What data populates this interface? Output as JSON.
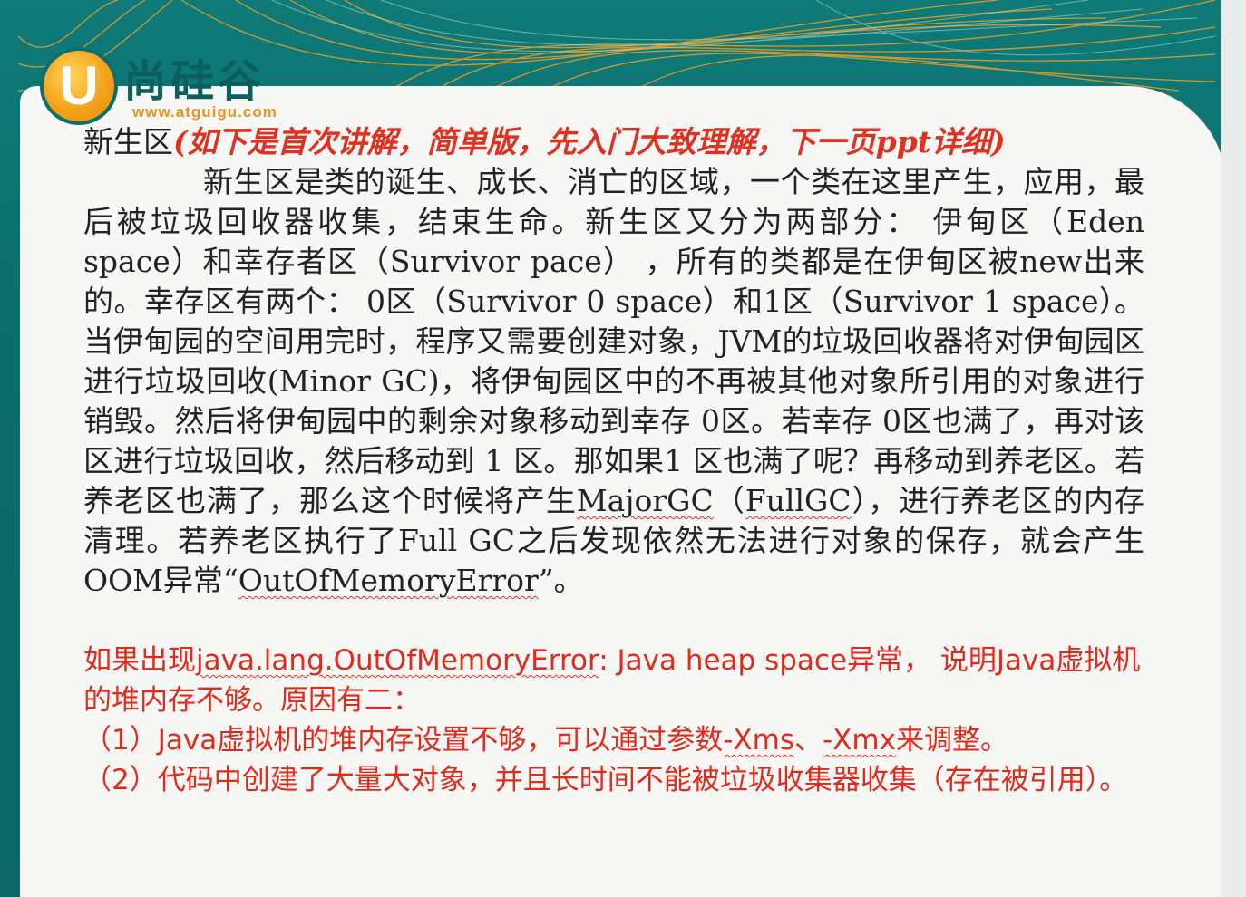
{
  "logo": {
    "mark": "U",
    "name": "尚硅谷",
    "url": "www.atguigu.com"
  },
  "colors": {
    "background_teal": "#0f7a78",
    "accent_orange": "#f5a31a",
    "panel": "#f7f7f5",
    "highlight_red": "#e02b1c",
    "text": "#222222"
  },
  "heading": {
    "title": "新生区",
    "note": "(如下是首次讲解，简单版，先入门大致理解，下一页ppt详细)"
  },
  "body": {
    "p1": "新生区是类的诞生、成长、消亡的区域，一个类在这里产生，应用，最后被垃圾回收器收集，结束生命。新生区又分为两部分： 伊甸区（Eden space）和幸存者区（Survivor pace） ，所有的类都是在伊甸区被new出来的。幸存区有两个： 0区（Survivor 0 space）和1区（Survivor 1 space）。当伊甸园的空间用完时，程序又需要创建对象，JVM的垃圾回收器将对伊甸园区进行垃圾回收(Minor GC)，将伊甸园区中的不再被其他对象所引用的对象进行销毁。然后将伊甸园中的剩余对象移动到幸存 0区。若幸存 0区也满了，再对该区进行垃圾回收，然后移动到 1 区。那如果1 区也满了呢？再移动到养老区。若养老区也满了，那么这个时候将产生",
    "major_gc": "MajorGC",
    "p1_mid1": "（",
    "full_gc": "FullGC",
    "p1_mid2": "），进行养老区的内存清理。若养老区执行了Full GC之后发现依然无法进行对象的保存，就会产生OOM异常“",
    "oom": "OutOfMemoryError",
    "p1_end": "”。"
  },
  "red": {
    "line1_a": "如果出现",
    "line1_err": "java.lang.OutOfMemoryError",
    "line1_b": ": Java heap space异常， 说明Java虚拟机的堆内存不够。原因有二：",
    "line2_a": "（1）Java虚拟机的堆内存设置不够，可以通过参数",
    "xms": "-Xms",
    "sep": "、",
    "xmx": "-Xmx",
    "line2_b": "来调整。",
    "line3": "（2）代码中创建了大量大对象，并且长时间不能被垃圾收集器收集（存在被引用）。"
  }
}
